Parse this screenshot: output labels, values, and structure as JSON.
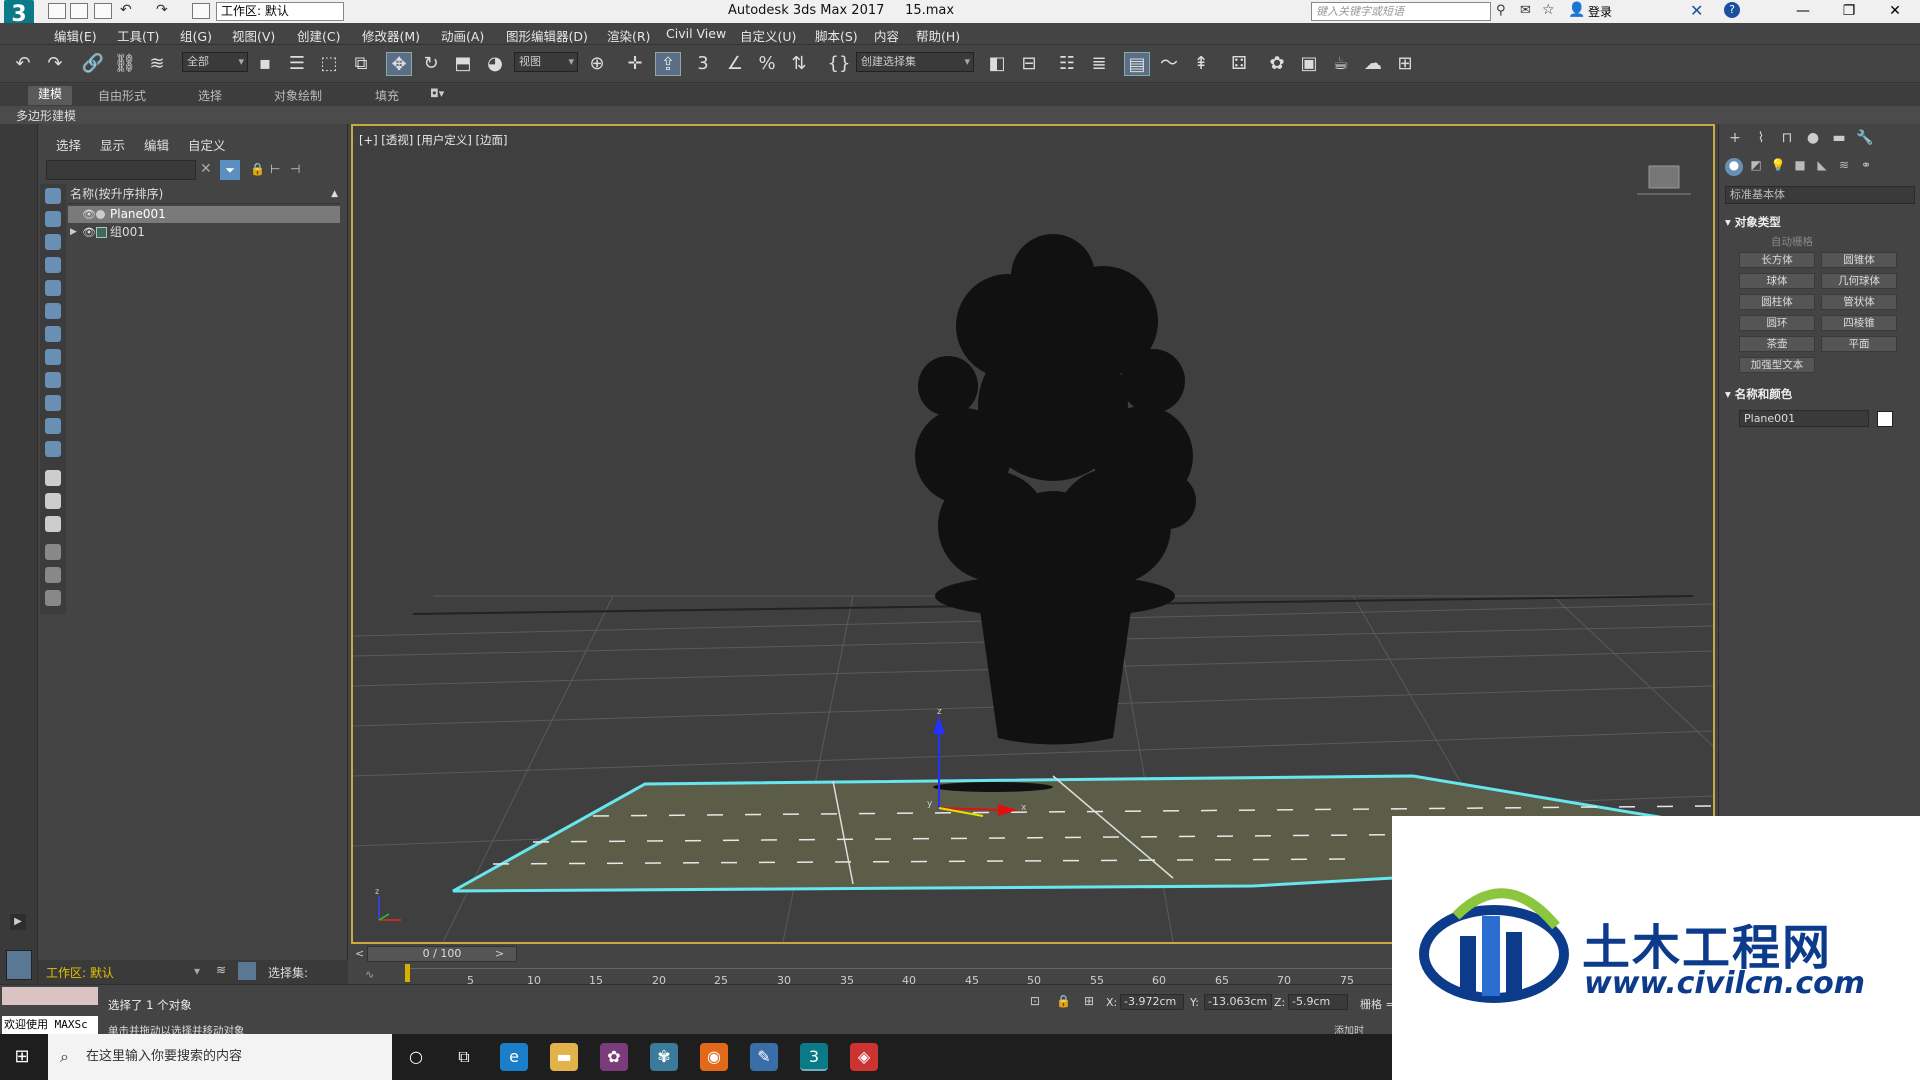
{
  "titlebar": {
    "workspace": "工作区: 默认",
    "app_title": "Autodesk 3ds Max 2017",
    "file_name": "15.max",
    "search_placeholder": "键入关键字或短语",
    "login": "登录"
  },
  "menu": [
    "编辑(E)",
    "工具(T)",
    "组(G)",
    "视图(V)",
    "创建(C)",
    "修改器(M)",
    "动画(A)",
    "图形编辑器(D)",
    "渲染(R)",
    "Civil View",
    "自定义(U)",
    "脚本(S)",
    "内容",
    "帮助(H)"
  ],
  "toolbar": {
    "selection_filter": "全部",
    "ref_coord": "视图",
    "named_selection": "创建选择集"
  },
  "ribbon": {
    "tabs": [
      "建模",
      "自由形式",
      "选择",
      "对象绘制",
      "填充"
    ],
    "active_tab": "建模",
    "sub_label": "多边形建模"
  },
  "scene_explorer": {
    "menu": [
      "选择",
      "显示",
      "编辑",
      "自定义"
    ],
    "column_header": "名称(按升序排序)",
    "rows": [
      {
        "name": "Plane001",
        "selected": true
      },
      {
        "name": "组001",
        "selected": false
      }
    ]
  },
  "viewport": {
    "label": "[+] [透视] [用户定义] [边面]"
  },
  "command_panel": {
    "dropdown": "标准基本体",
    "object_type_title": "对象类型",
    "auto_grid": "自动栅格",
    "buttons": [
      "长方体",
      "圆锥体",
      "球体",
      "几何球体",
      "圆柱体",
      "管状体",
      "圆环",
      "四棱锥",
      "茶壶",
      "平面",
      "加强型文本"
    ],
    "name_color_title": "名称和颜色",
    "object_name": "Plane001",
    "object_color": "#ffffff"
  },
  "timeline": {
    "frame": "0 / 100",
    "ticks": [
      "5",
      "10",
      "15",
      "20",
      "25",
      "30",
      "35",
      "40",
      "45",
      "50",
      "55",
      "60",
      "65",
      "70",
      "75"
    ]
  },
  "workspace_bottom": {
    "workspace": "工作区: 默认",
    "selection_set": "选择集:"
  },
  "status": {
    "welcome": "欢迎使用 MAXSc",
    "line1": "选择了 1 个对象",
    "line2": "单击并拖动以选择并移动对象",
    "x": "-3.972cm",
    "y": "-13.063cm",
    "z": "-5.9cm",
    "grid_label": "栅格 =",
    "add_time": "添加时"
  },
  "taskbar": {
    "search": "在这里输入你要搜索的内容"
  },
  "watermark": {
    "cn": "土木工程网",
    "url": "www.civilcn.com"
  },
  "colors": {
    "viewport_border": "#c9a940",
    "selection_outline": "#66e6ee",
    "ground_fill": "#5b5d49",
    "watermark_blue": "#0d3b8c"
  }
}
